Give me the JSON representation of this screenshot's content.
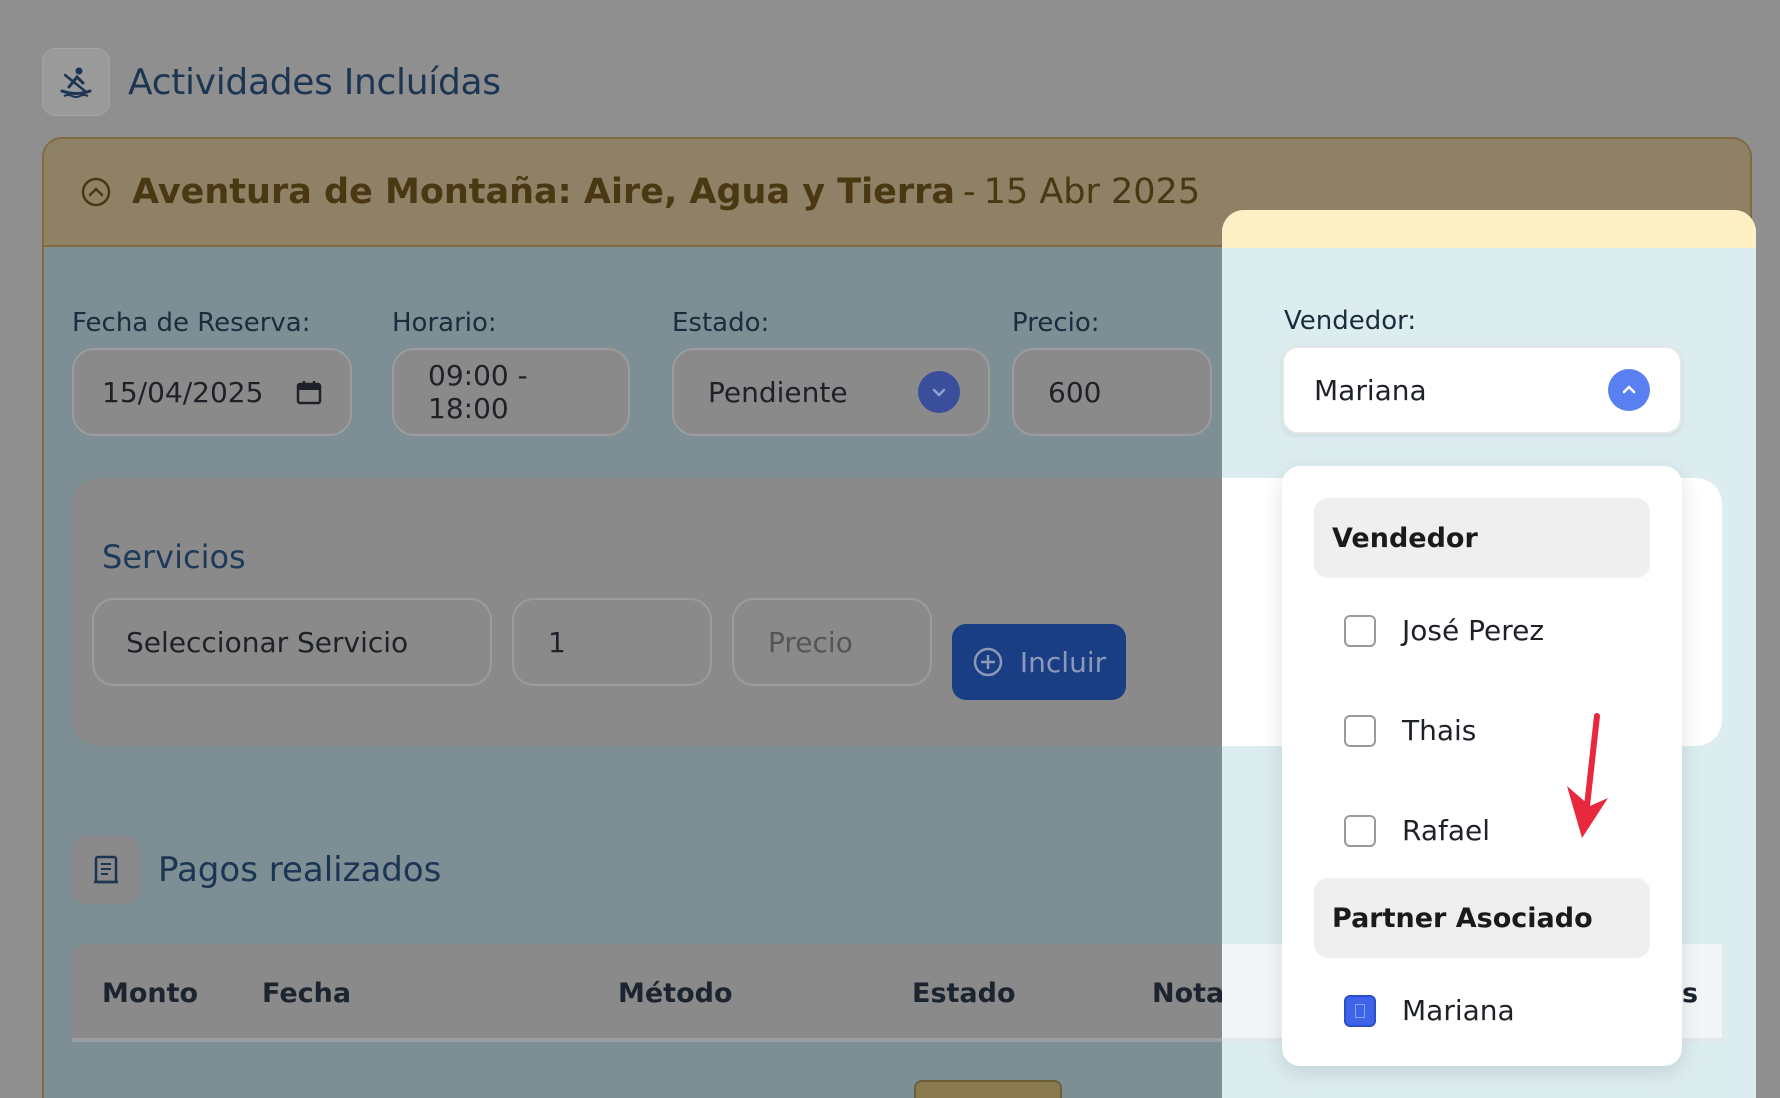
{
  "header": {
    "title": "Actividades Incluídas",
    "icon": "kayak-icon"
  },
  "activity": {
    "title": "Aventura de Montaña: Aire, Agua y Tierra",
    "separator": "-",
    "date": "15 Abr 2025"
  },
  "form": {
    "fecha_label": "Fecha de Reserva:",
    "fecha_value": "15/04/2025",
    "horario_label": "Horario:",
    "horario_value": "09:00 - 18:00",
    "estado_label": "Estado:",
    "estado_value": "Pendiente",
    "precio_label": "Precio:",
    "precio_value": "600",
    "vendedor_label": "Vendedor:",
    "vendedor_value": "Mariana"
  },
  "servicios": {
    "title": "Servicios",
    "select_value": "Seleccionar Servicio",
    "quantity_value": "1",
    "price_placeholder": "Precio",
    "include_label": "Incluir"
  },
  "pagos": {
    "title": "Pagos realizados",
    "columns": [
      "Monto",
      "Fecha",
      "Método",
      "Estado",
      "Notas"
    ],
    "last_column_partial": "s"
  },
  "vendor_dropdown": {
    "groups": [
      {
        "label": "Vendedor",
        "options": [
          {
            "label": "José Perez",
            "checked": false
          },
          {
            "label": "Thais",
            "checked": false
          },
          {
            "label": "Rafael",
            "checked": false
          }
        ]
      },
      {
        "label": "Partner Asociado",
        "options": [
          {
            "label": "Mariana",
            "checked": true
          }
        ]
      }
    ]
  },
  "colors": {
    "accent_blue": "#3d63e8",
    "incluir_button": "#1a3e84",
    "arrow_red": "#e8283c",
    "activity_header": "#fdf0c4"
  }
}
